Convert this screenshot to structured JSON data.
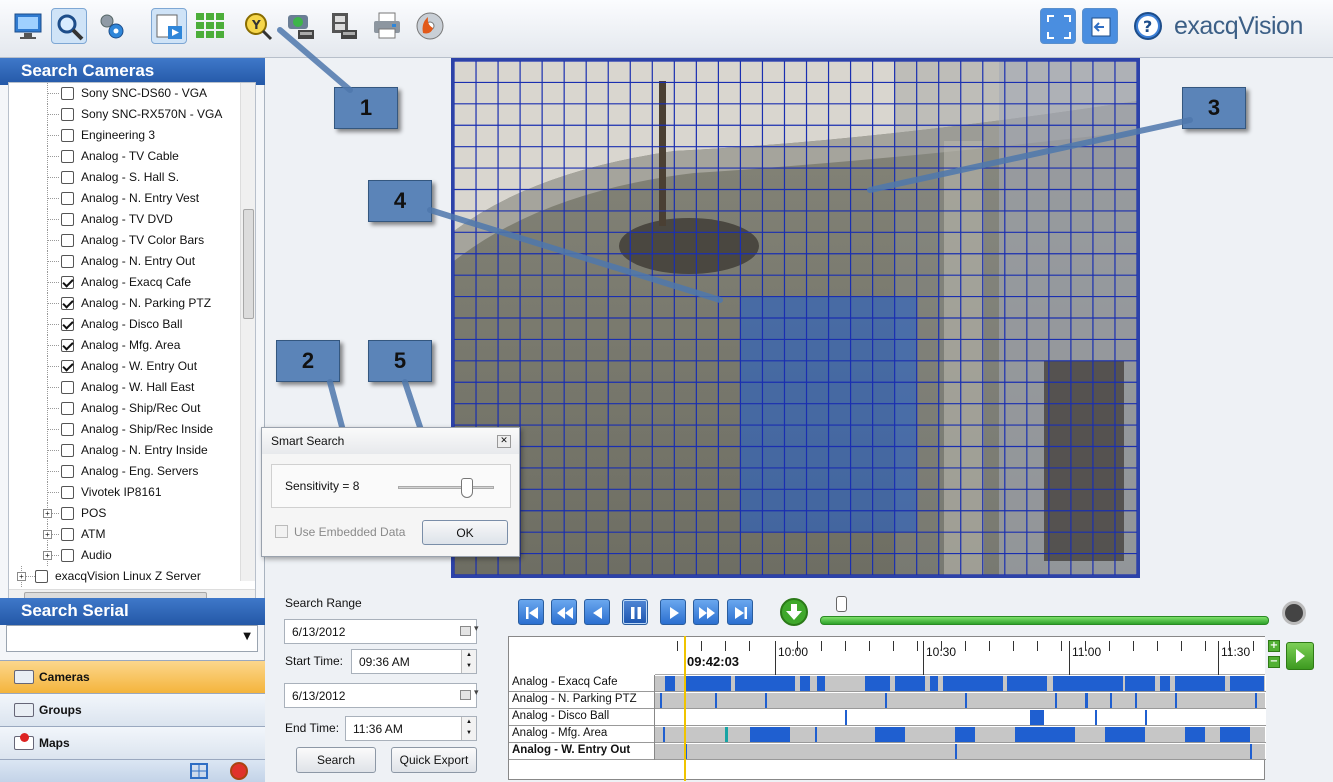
{
  "app": {
    "brand": "exacqVision"
  },
  "toolbar": {
    "buttons": [
      "live-view",
      "search",
      "config",
      "search-mode",
      "grid-layout",
      "smart-search",
      "export-cameras",
      "export-video",
      "print",
      "burn-disc"
    ],
    "right_buttons": [
      "fullscreen",
      "undock",
      "help"
    ]
  },
  "left_panel": {
    "search_cameras_title": "Search Cameras",
    "cameras": [
      {
        "label": "Sony SNC-DS60 - VGA",
        "checked": false
      },
      {
        "label": "Sony SNC-RX570N - VGA",
        "checked": false
      },
      {
        "label": "Engineering 3",
        "checked": false
      },
      {
        "label": "Analog - TV Cable",
        "checked": false
      },
      {
        "label": "Analog - S. Hall S.",
        "checked": false
      },
      {
        "label": "Analog - N. Entry Vest",
        "checked": false
      },
      {
        "label": "Analog - TV DVD",
        "checked": false
      },
      {
        "label": "Analog - TV Color Bars",
        "checked": false
      },
      {
        "label": "Analog - N. Entry Out",
        "checked": false
      },
      {
        "label": "Analog - Exacq Cafe",
        "checked": true
      },
      {
        "label": "Analog - N. Parking PTZ",
        "checked": true
      },
      {
        "label": "Analog - Disco Ball",
        "checked": true
      },
      {
        "label": "Analog - Mfg. Area",
        "checked": true
      },
      {
        "label": "Analog - W. Entry Out",
        "checked": true
      },
      {
        "label": "Analog - W. Hall East",
        "checked": false
      },
      {
        "label": "Analog - Ship/Rec Out",
        "checked": false
      },
      {
        "label": "Analog - Ship/Rec Inside",
        "checked": false
      },
      {
        "label": "Analog - N. Entry Inside",
        "checked": false
      },
      {
        "label": "Analog - Eng. Servers",
        "checked": false
      },
      {
        "label": "Vivotek IP8161",
        "checked": false
      }
    ],
    "groups_tree": [
      {
        "label": "POS",
        "checked": false
      },
      {
        "label": "ATM",
        "checked": false
      },
      {
        "label": "Audio",
        "checked": false
      }
    ],
    "server": {
      "label": "exacqVision Linux Z Server",
      "checked": false
    },
    "search_serial_title": "Search Serial",
    "serial_value": "",
    "nav": {
      "cameras": "Cameras",
      "groups": "Groups",
      "maps": "Maps"
    }
  },
  "callouts": [
    "1",
    "2",
    "3",
    "4",
    "5"
  ],
  "smart_search": {
    "title": "Smart Search",
    "sensitivity_label": "Sensitivity = 8",
    "sensitivity": 8,
    "use_embedded_label": "Use Embedded Data",
    "use_embedded_checked": false,
    "ok_label": "OK"
  },
  "search_range": {
    "title": "Search Range",
    "start_date": "6/13/2012",
    "start_time_label": "Start Time:",
    "start_time": "09:36 AM",
    "end_date": "6/13/2012",
    "end_time_label": "End Time:",
    "end_time": "11:36 AM",
    "search_label": "Search",
    "quick_export_label": "Quick Export"
  },
  "timeline": {
    "current_time": "09:42:03",
    "ticks": [
      "10:00",
      "10:30",
      "11:00",
      "11:30"
    ],
    "rows": [
      {
        "name": "Analog - Exacq Cafe",
        "bold": false
      },
      {
        "name": "Analog - N. Parking PTZ",
        "bold": false
      },
      {
        "name": "Analog - Disco Ball",
        "bold": false
      },
      {
        "name": "Analog - Mfg. Area",
        "bold": false
      },
      {
        "name": "Analog - W. Entry Out",
        "bold": true
      }
    ]
  },
  "colors": {
    "accent": "#2458a7",
    "grid": "#1a2fb0",
    "motion": "#1f5fd0"
  }
}
